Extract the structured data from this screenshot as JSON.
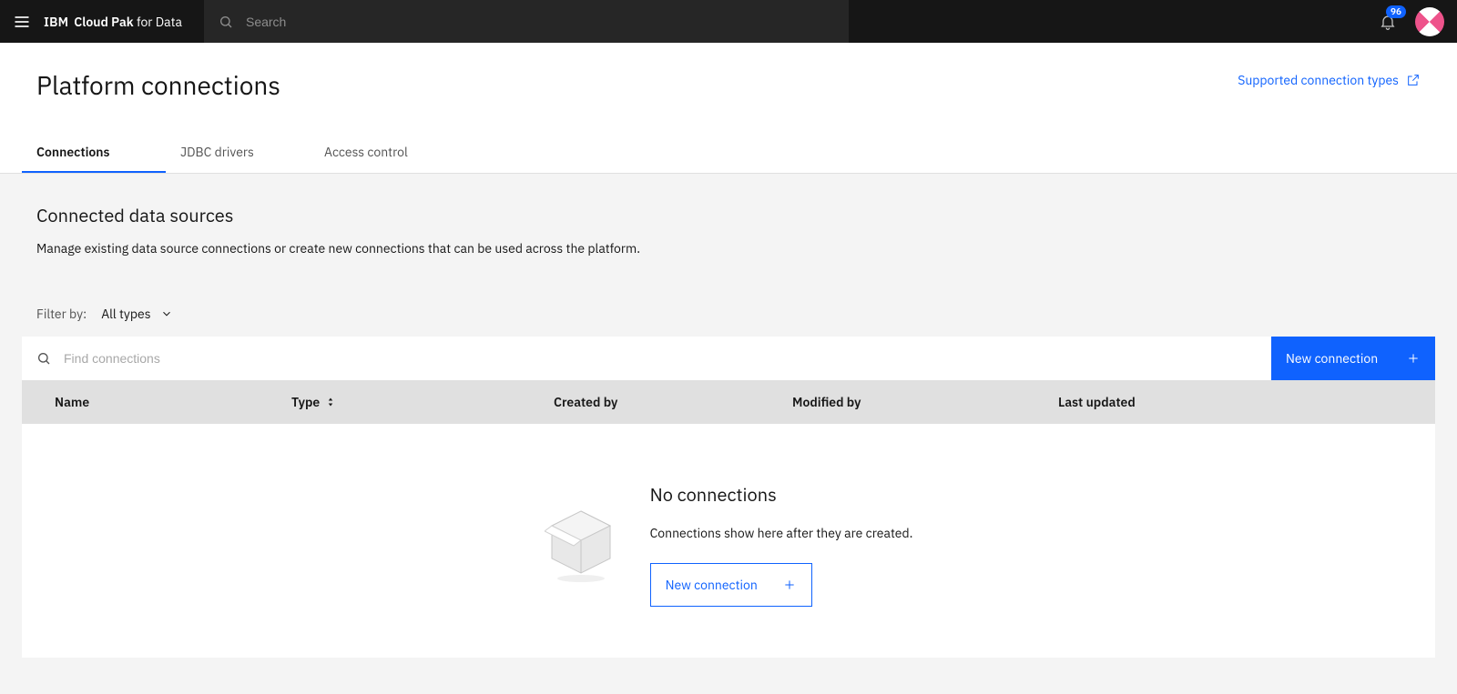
{
  "header": {
    "brand_company": "IBM",
    "brand_product_bold": "Cloud Pak",
    "brand_product_light": " for Data",
    "search_placeholder": "Search",
    "notification_count": "96"
  },
  "page": {
    "title": "Platform connections",
    "supported_link": "Supported connection types"
  },
  "tabs": [
    {
      "label": "Connections",
      "active": true
    },
    {
      "label": "JDBC drivers",
      "active": false
    },
    {
      "label": "Access control",
      "active": false
    }
  ],
  "section": {
    "title": "Connected data sources",
    "description": "Manage existing data source connections or create new connections that can be used across the platform."
  },
  "filter": {
    "label": "Filter by:",
    "selected": "All types"
  },
  "toolbar": {
    "search_placeholder": "Find connections",
    "new_button_label": "New connection"
  },
  "table": {
    "columns": {
      "name": "Name",
      "type": "Type",
      "created_by": "Created by",
      "modified_by": "Modified by",
      "last_updated": "Last updated"
    },
    "rows": []
  },
  "empty": {
    "title": "No connections",
    "description": "Connections show here after they are created.",
    "button_label": "New connection"
  }
}
